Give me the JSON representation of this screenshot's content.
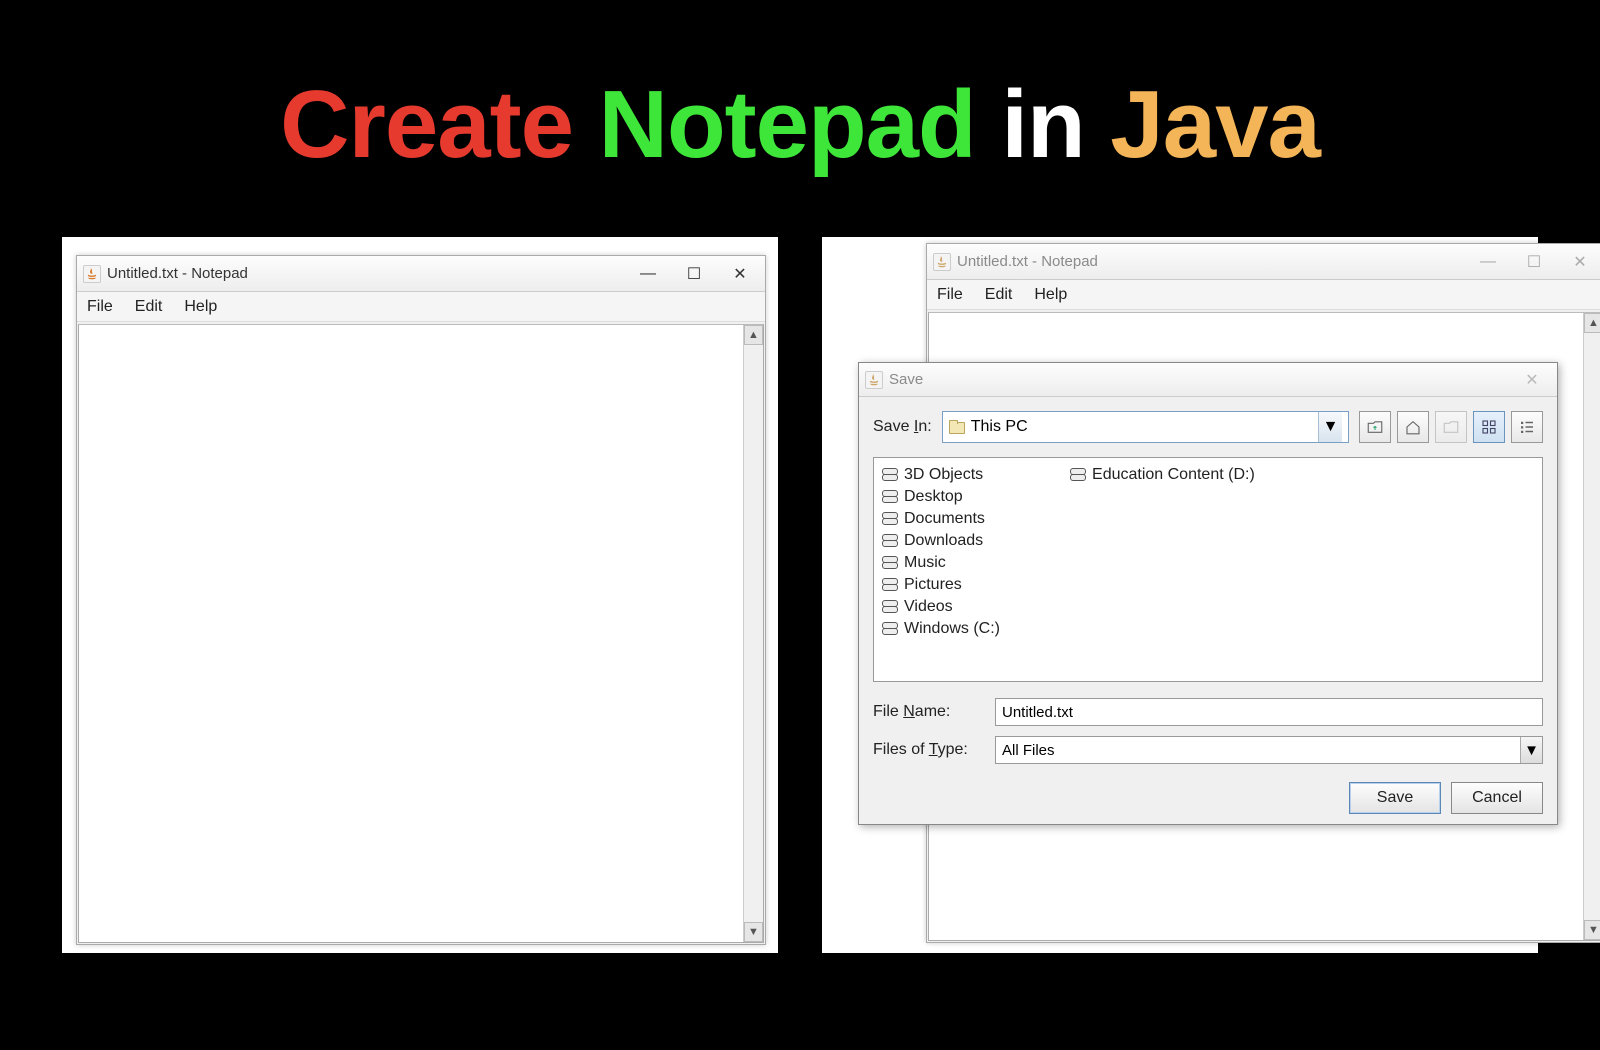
{
  "heading": {
    "w1": "Create",
    "w2": "Notepad",
    "w3": "in",
    "w4": "Java"
  },
  "notepad": {
    "title": "Untitled.txt - Notepad",
    "menu": {
      "file": "File",
      "edit": "Edit",
      "help": "Help"
    }
  },
  "saveDialog": {
    "title": "Save",
    "saveInLabelPre": "Save ",
    "saveInLabelU": "I",
    "saveInLabelPost": "n:",
    "saveInValue": "This PC",
    "items": {
      "col1": [
        "3D Objects",
        "Desktop",
        "Documents",
        "Downloads",
        "Music",
        "Pictures",
        "Videos",
        "Windows (C:)"
      ],
      "col2": [
        "Education Content (D:)"
      ]
    },
    "fileNameLabelPre": "File ",
    "fileNameLabelU": "N",
    "fileNameLabelPost": "ame:",
    "fileNameValue": "Untitled.txt",
    "fileTypeLabelPre": "Files of ",
    "fileTypeLabelU": "T",
    "fileTypeLabelPost": "ype:",
    "fileTypeValue": "All Files",
    "saveBtn": "Save",
    "cancelBtn": "Cancel"
  }
}
